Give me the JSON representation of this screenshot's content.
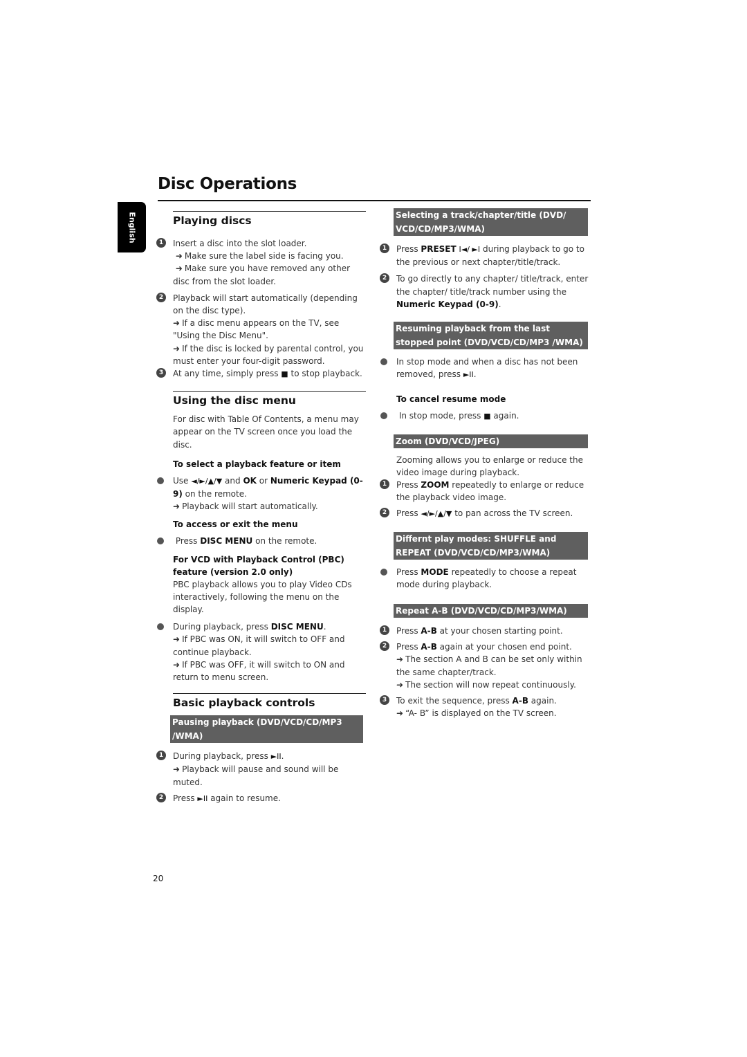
{
  "page": {
    "title": "Disc Operations",
    "language_tab": "English",
    "page_number": "20"
  },
  "left": {
    "playing": {
      "title": "Playing discs",
      "steps": [
        {
          "num": "1",
          "text": "Insert a disc into the slot loader.",
          "notes": [
            "Make sure the label side is facing you.",
            "Make sure you have removed any other disc from the slot loader."
          ]
        },
        {
          "num": "2",
          "text": "Playback will start automatically (depending on the disc type).",
          "notes": [
            "If a disc menu appears on the TV, see \"Using the Disc Menu\".",
            "If the disc is locked by parental control, you must enter your four-digit password."
          ]
        },
        {
          "num": "3",
          "text_before": "At any time, simply press",
          "icon": "■",
          "text_after": "to stop playback."
        }
      ]
    },
    "disc_menu": {
      "title": "Using the disc menu",
      "intro": "For disc with Table Of Contents, a menu may appear on the TV screen once you load the disc.",
      "select_head": "To select a playback feature or item",
      "select_use": "Use",
      "select_arrows": "◄/►/▲/▼",
      "select_and": "and",
      "select_ok": "OK",
      "select_or": "or",
      "select_keypad": "Numeric Keypad (0-9)",
      "select_remote": "on the remote.",
      "select_note": "Playback will start automatically.",
      "access_head": "To access or exit the menu",
      "access_press": "Press",
      "access_key": "DISC MENU",
      "access_rest": "on the remote.",
      "pbc_head": "For VCD with Playback Control (PBC) feature (version 2.0 only)",
      "pbc_intro": "PBC playback allows you to play Video CDs interactively, following the menu on the display.",
      "pbc_press": "During playback, press",
      "pbc_key": "DISC MENU",
      "pbc_notes": [
        "If PBC was ON, it will switch to OFF and continue playback.",
        "If PBC was OFF, it will switch to ON and return to menu screen."
      ]
    },
    "basic": {
      "title": "Basic playback controls",
      "pause_box": "Pausing playback (DVD/VCD/CD/MP3 /WMA)",
      "step1_text": "During playback, press",
      "step1_icon": "►II",
      "step1_note": "Playback will pause and sound will be muted.",
      "step2_before": "Press",
      "step2_icon": "►II",
      "step2_after": "again to resume."
    }
  },
  "right": {
    "select_track": {
      "box": "Selecting a track/chapter/title (DVD/ VCD/CD/MP3/WMA)",
      "step1_press": "Press",
      "step1_key": "PRESET",
      "step1_icons": "I◄/ ►I",
      "step1_rest": "during playback to go to the previous or next chapter/title/track.",
      "step2_text": "To go directly to any chapter/ title/track, enter the chapter/ title/track number using the",
      "step2_key": "Numeric Keypad (0-9)"
    },
    "resume": {
      "box": "Resuming playback from the last stopped point (DVD/VCD/CD/MP3 /WMA)",
      "bullet_text": "In stop mode and when a disc has not been removed, press",
      "bullet_icon": "►II",
      "cancel_head": "To cancel resume mode",
      "cancel_before": "In stop mode, press",
      "cancel_icon": "■",
      "cancel_after": "again."
    },
    "zoom": {
      "box": "Zoom (DVD/VCD/JPEG)",
      "intro": "Zooming allows you to enlarge or reduce the video image during playback.",
      "step1_press": "Press",
      "step1_key": "ZOOM",
      "step1_rest": "repeatedly to enlarge or reduce the playback video image.",
      "step2_press": "Press",
      "step2_arrows": "◄/►/▲/▼",
      "step2_rest": "to pan across the TV screen."
    },
    "modes": {
      "box": "Differnt play modes: SHUFFLE and REPEAT (DVD/VCD/CD/MP3/WMA)",
      "bullet_press": "Press",
      "bullet_key": "MODE",
      "bullet_rest": "repeatedly to choose a repeat mode during playback."
    },
    "repeat_ab": {
      "box": "Repeat A-B (DVD/VCD/CD/MP3/WMA)",
      "step1_press": "Press",
      "step1_key": "A-B",
      "step1_rest": "at your chosen starting point.",
      "step2_press": "Press",
      "step2_key": "A-B",
      "step2_rest": "again at your chosen end point.",
      "step2_notes": [
        "The section A and B can be set only within the same chapter/track.",
        "The section will now repeat continuously."
      ],
      "step3_text": "To exit the sequence, press",
      "step3_key": "A-B",
      "step3_rest": "again.",
      "step3_note_display": "“A- B”",
      "step3_note_rest": "is displayed on the TV screen."
    }
  }
}
